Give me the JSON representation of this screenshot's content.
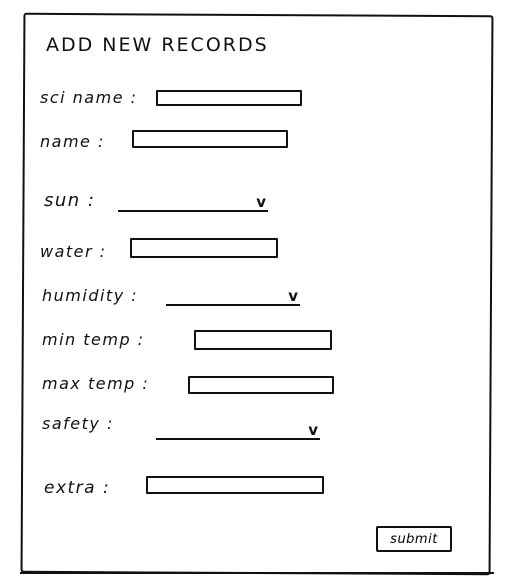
{
  "form": {
    "title": "ADD NEW RECORDS",
    "fields": {
      "sci_name": {
        "label": "sci name :",
        "value": ""
      },
      "name": {
        "label": "name :",
        "value": ""
      },
      "sun": {
        "label": "sun :",
        "selected": ""
      },
      "water": {
        "label": "water :",
        "value": ""
      },
      "humidity": {
        "label": "humidity :",
        "selected": ""
      },
      "min_temp": {
        "label": "min temp :",
        "value": ""
      },
      "max_temp": {
        "label": "max temp :",
        "value": ""
      },
      "safety": {
        "label": "safety :",
        "selected": ""
      },
      "extra": {
        "label": "extra :",
        "value": ""
      }
    },
    "dropdown_glyph": "v",
    "submit_label": "submit"
  },
  "icons": {
    "dropdown": "chevron-down-icon"
  }
}
